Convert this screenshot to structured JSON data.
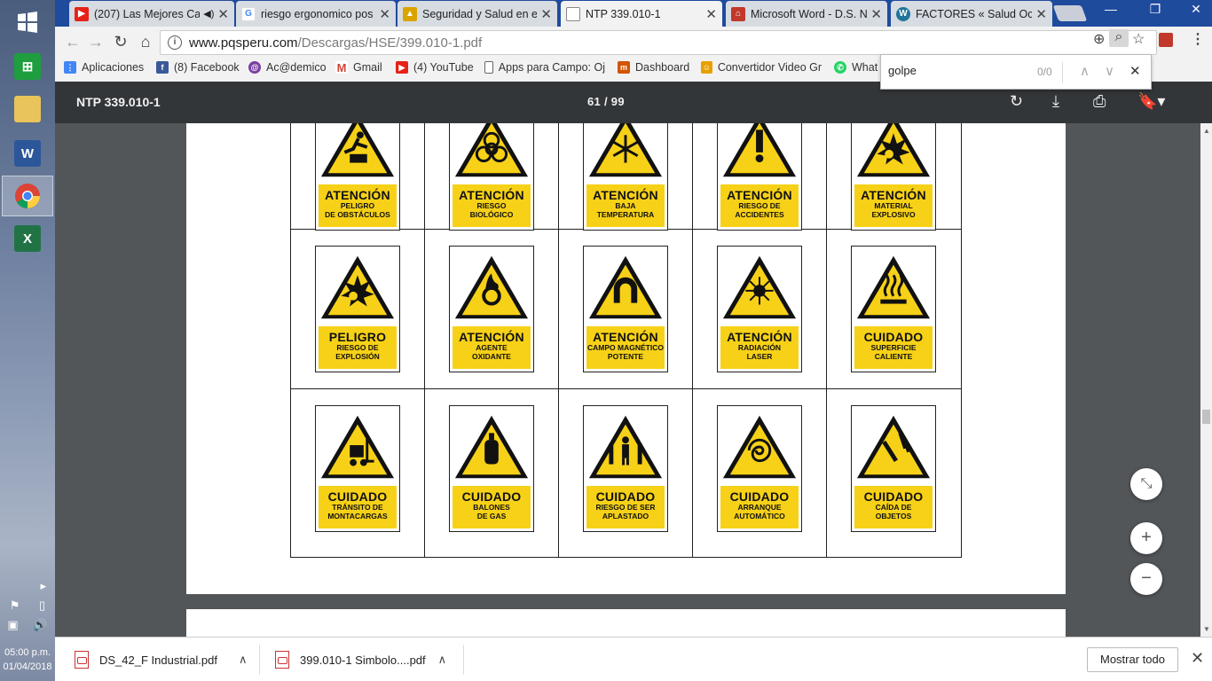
{
  "browser": {
    "tabs": [
      {
        "title": "(207) Las Mejores Ca",
        "icon": "youtube-icon",
        "color": "#e62117",
        "active": false
      },
      {
        "title": "riesgo ergonomico pos",
        "icon": "google-icon",
        "color": "#4285f4",
        "active": false
      },
      {
        "title": "Seguridad y Salud en el",
        "icon": "helmet-icon",
        "color": "#d9a400",
        "active": false
      },
      {
        "title": "NTP 339.010-1",
        "icon": "document-icon",
        "color": "#777777",
        "active": true
      },
      {
        "title": "Microsoft Word - D.S. N",
        "icon": "sitemap-icon",
        "color": "#c0392b",
        "active": false
      },
      {
        "title": "FACTORES « Salud Ocu",
        "icon": "wordpress-icon",
        "color": "#21759b",
        "active": false
      }
    ],
    "url_host": "www.pqsperu.com",
    "url_path": "/Descargas/HSE/399.010-1.pdf",
    "bookmarks": [
      {
        "label": "Aplicaciones",
        "icon": "apps-grid-icon",
        "color": "#4285f4"
      },
      {
        "label": "(8) Facebook",
        "icon": "facebook-icon",
        "color": "#3b5998"
      },
      {
        "label": "Ac@demico",
        "icon": "academic-icon",
        "color": "#7a3fa0"
      },
      {
        "label": "Gmail",
        "icon": "gmail-icon",
        "color": "#d44638"
      },
      {
        "label": "(4) YouTube",
        "icon": "youtube-icon",
        "color": "#e62117"
      },
      {
        "label": "Apps para Campo: Oj",
        "icon": "page-icon",
        "color": "#666666"
      },
      {
        "label": "Dashboard",
        "icon": "dashboard-icon",
        "color": "#d35400"
      },
      {
        "label": "Convertidor Video Gr",
        "icon": "converter-icon",
        "color": "#e8a000"
      },
      {
        "label": "What",
        "icon": "whatsapp-icon",
        "color": "#25d366"
      }
    ],
    "find": {
      "query": "golpe",
      "count": "0/0"
    }
  },
  "pdf": {
    "title": "NTP 339.010-1",
    "page_indicator": "61  /  99",
    "signs": [
      {
        "heading": "ATENCIÓN",
        "sub": "PELIGRO\nDE OBSTÁCULOS",
        "symbol": "obstacle-icon"
      },
      {
        "heading": "ATENCIÓN",
        "sub": "RIESGO\nBIOLÓGICO",
        "symbol": "biohazard-icon"
      },
      {
        "heading": "ATENCIÓN",
        "sub": "BAJA\nTEMPERATURA",
        "symbol": "snowflake-icon"
      },
      {
        "heading": "ATENCIÓN",
        "sub": "RIESGO DE\nACCIDENTES",
        "symbol": "exclamation-icon"
      },
      {
        "heading": "ATENCIÓN",
        "sub": "MATERIAL\nEXPLOSIVO",
        "symbol": "explosion-icon"
      },
      {
        "heading": "PELIGRO",
        "sub": "RIESGO DE\nEXPLOSIÓN",
        "symbol": "explosion-icon"
      },
      {
        "heading": "ATENCIÓN",
        "sub": "AGENTE\nOXIDANTE",
        "symbol": "oxidizer-icon"
      },
      {
        "heading": "ATENCIÓN",
        "sub": "CAMPO MAGNÉTICO\nPOTENTE",
        "symbol": "magnet-icon"
      },
      {
        "heading": "ATENCIÓN",
        "sub": "RADIACIÓN\nLASER",
        "symbol": "laser-icon"
      },
      {
        "heading": "CUIDADO",
        "sub": "SUPERFICIE\nCALIENTE",
        "symbol": "hot-surface-icon"
      },
      {
        "heading": "CUIDADO",
        "sub": "TRÁNSITO DE\nMONTACARGAS",
        "symbol": "forklift-icon"
      },
      {
        "heading": "CUIDADO",
        "sub": "BALONES\nDE GAS",
        "symbol": "gas-cylinder-icon"
      },
      {
        "heading": "CUIDADO",
        "sub": "RIESGO DE SER\nAPLASTADO",
        "symbol": "crush-icon"
      },
      {
        "heading": "CUIDADO",
        "sub": "ARRANQUE\nAUTOMÁTICO",
        "symbol": "auto-start-icon"
      },
      {
        "heading": "CUIDADO",
        "sub": "CAÍDA DE\nOBJETOS",
        "symbol": "falling-objects-icon"
      }
    ],
    "sign_yellow": "#f7d117"
  },
  "downloads": {
    "items": [
      {
        "name": "DS_42_F Industrial.pdf"
      },
      {
        "name": "399.010-1 Simbolo....pdf"
      }
    ],
    "show_all": "Mostrar todo"
  },
  "system": {
    "time": "05:00 p.m.",
    "date": "01/04/2018"
  }
}
